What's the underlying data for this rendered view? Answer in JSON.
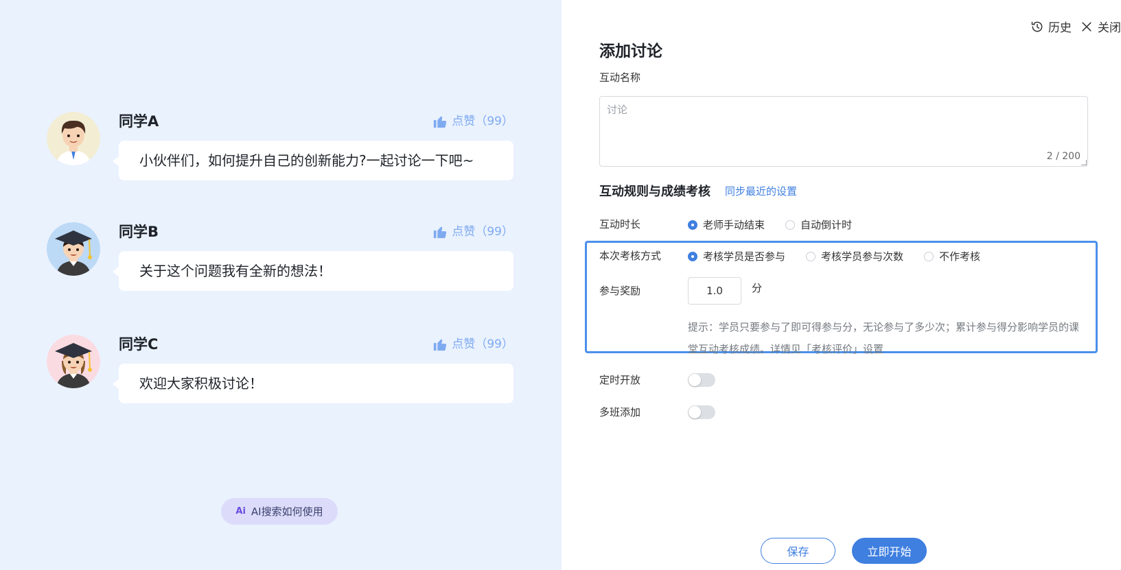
{
  "preview": {
    "messages": [
      {
        "name": "同学A",
        "text": "小伙伴们，如何提升自己的创新能力?一起讨论一下吧~",
        "like_label": "点赞（99）",
        "avatar": "boy-avatar-icon"
      },
      {
        "name": "同学B",
        "text": "关于这个问题我有全新的想法！",
        "like_label": "点赞（99）",
        "avatar": "graduate-boy-avatar-icon"
      },
      {
        "name": "同学C",
        "text": "欢迎大家积极讨论！",
        "like_label": "点赞（99）",
        "avatar": "graduate-girl-avatar-icon"
      }
    ],
    "ai_button": {
      "mark": "Ai",
      "label": "AI搜索如何使用"
    }
  },
  "header": {
    "history_label": "历史",
    "close_label": "关闭"
  },
  "form": {
    "title": "添加讨论",
    "name_label": "互动名称",
    "name_value": "",
    "name_placeholder": "讨论",
    "char_count": "2 / 200",
    "section_title": "互动规则与成绩考核",
    "sync_link": "同步最近的设置",
    "duration": {
      "label": "互动时长",
      "options": [
        {
          "label": "老师手动结束",
          "checked": true
        },
        {
          "label": "自动倒计时",
          "checked": false
        }
      ]
    },
    "assessment": {
      "label": "本次考核方式",
      "options": [
        {
          "label": "考核学员是否参与",
          "checked": true
        },
        {
          "label": "考核学员参与次数",
          "checked": false
        },
        {
          "label": "不作考核",
          "checked": false
        }
      ]
    },
    "reward": {
      "label": "参与奖励",
      "value": "1.0",
      "unit": "分",
      "hint": "提示：学员只要参与了即可得参与分，无论参与了多少次；累计参与得分影响学员的课堂互动考核成绩。详情见「考核评价」设置"
    },
    "scheduled_open": {
      "label": "定时开放",
      "on": false
    },
    "multi_class": {
      "label": "多班添加",
      "on": false
    }
  },
  "footer": {
    "save_label": "保存",
    "start_label": "立即开始"
  },
  "colors": {
    "accent": "#3f7fe0",
    "highlight_border": "#4a90ea",
    "preview_bg": "#eaf2fe",
    "like": "#7eaaf0"
  }
}
